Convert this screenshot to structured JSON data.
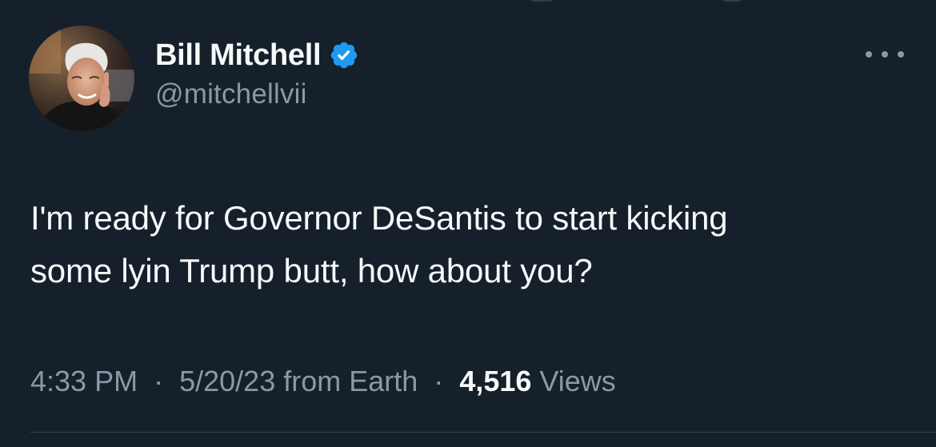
{
  "tweet": {
    "author": {
      "display_name": "Bill Mitchell",
      "handle": "@mitchellvii",
      "verified": true,
      "avatar_icon": "profile-photo"
    },
    "text_lines": [
      "I'm ready for Governor DeSantis to start kicking",
      "some lyin Trump butt, how about you?"
    ],
    "meta": {
      "time": "4:33 PM",
      "separator": "·",
      "date_source": "5/20/23 from Earth",
      "views_count": "4,516",
      "views_label": "Views"
    },
    "more_icon": "more-horizontal-icon"
  },
  "colors": {
    "background": "#15202b",
    "primary_text": "#f7f9f9",
    "secondary_text": "#8b98a5",
    "verified_badge": "#1d9bf0",
    "divider": "#38444d"
  }
}
